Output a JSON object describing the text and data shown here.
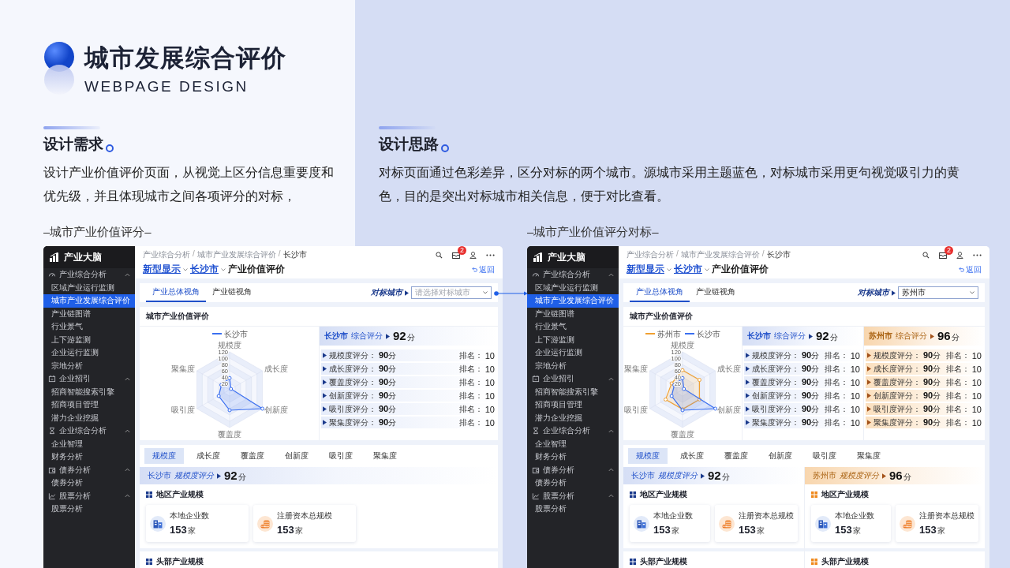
{
  "header": {
    "title": "城市发展综合评价",
    "subtitle": "WEBPAGE DESIGN"
  },
  "notes": [
    {
      "heading": "设计需求",
      "text": "设计产业价值评价页面，从视觉上区分信息重要度和优先级，并且体现城市之间各项评分的对标，"
    },
    {
      "heading": "设计思路",
      "text": "对标页面通过色彩差异，区分对标的两个城市。源城市采用主题蓝色，对标城市采用更句视觉吸引力的黄色，目的是突出对标城市相关信息，便于对比查看。"
    }
  ],
  "screens": [
    {
      "caption": "–城市产业价值评分–",
      "logo": "产业大脑",
      "sidebar": [
        {
          "label": "产业综合分析",
          "expanded": true,
          "children": [
            {
              "label": "区域产业运行监测",
              "selected": false
            },
            {
              "label": "城市产业发展综合评价",
              "selected": true
            },
            {
              "label": "产业链图谱",
              "selected": false
            },
            {
              "label": "行业景气",
              "selected": false
            },
            {
              "label": "上下游监测",
              "selected": false
            },
            {
              "label": "企业运行监测",
              "selected": false
            },
            {
              "label": "宗地分析",
              "selected": false
            }
          ]
        },
        {
          "label": "企业招引",
          "expanded": true,
          "children": [
            {
              "label": "招商智能搜索引擎",
              "selected": false
            },
            {
              "label": "招商项目管理",
              "selected": false
            },
            {
              "label": "潜力企业挖掘",
              "selected": false
            }
          ]
        },
        {
          "label": "企业综合分析",
          "expanded": true,
          "children": [
            {
              "label": "企业智理",
              "selected": false
            },
            {
              "label": "财务分析",
              "selected": false
            }
          ]
        },
        {
          "label": "债券分析",
          "expanded": true,
          "children": [
            {
              "label": "债券分析",
              "selected": false
            }
          ]
        },
        {
          "label": "股票分析",
          "expanded": true,
          "children": [
            {
              "label": "股票分析",
              "selected": false
            }
          ]
        }
      ],
      "breadcrumb": [
        "产业综合分析",
        "/",
        "城市产业发展综合评价",
        "/",
        "长沙市"
      ],
      "badge": "2",
      "title_links": [
        "新型显示",
        "长沙市"
      ],
      "title": "产业价值评价",
      "back": "返回",
      "view_tabs": [
        {
          "label": "产业总体视角",
          "selected": true
        },
        {
          "label": "产业链视角",
          "selected": false
        }
      ],
      "compare_label": "对标城市",
      "compare_field": {
        "placeholder": "请选择对标城市"
      },
      "chart_title": "城市产业价值评价",
      "radar": {
        "legend": [
          {
            "label": "长沙市",
            "kind": "source",
            "color": "#3a6ff0"
          }
        ],
        "axes": [
          "规模度",
          "成长度",
          "创新度",
          "覆盖度",
          "吸引度",
          "聚集度"
        ],
        "ticks": [
          "120",
          "100",
          "80",
          "60",
          "40",
          "20"
        ]
      },
      "panels": [
        {
          "kind": "source",
          "city": "长沙市",
          "label": "综合评分",
          "score": "92",
          "unit": "分",
          "rows": [
            {
              "label": "规模度评分：",
              "score": "90",
              "unit": "分",
              "rank_label": "排名：",
              "rank": "10"
            },
            {
              "label": "成长度评分：",
              "score": "90",
              "unit": "分",
              "rank_label": "排名：",
              "rank": "10"
            },
            {
              "label": "覆盖度评分：",
              "score": "90",
              "unit": "分",
              "rank_label": "排名：",
              "rank": "10"
            },
            {
              "label": "创新度评分：",
              "score": "90",
              "unit": "分",
              "rank_label": "排名：",
              "rank": "10"
            },
            {
              "label": "吸引度评分：",
              "score": "90",
              "unit": "分",
              "rank_label": "排名：",
              "rank": "10"
            },
            {
              "label": "聚集度评分：",
              "score": "90",
              "unit": "分",
              "rank_label": "排名：",
              "rank": "10"
            }
          ]
        }
      ],
      "metric_tabs": [
        {
          "label": "规模度",
          "selected": true
        },
        {
          "label": "成长度",
          "selected": false
        },
        {
          "label": "覆盖度",
          "selected": false
        },
        {
          "label": "创新度",
          "selected": false
        },
        {
          "label": "吸引度",
          "selected": false
        },
        {
          "label": "聚集度",
          "selected": false
        }
      ],
      "columns": [
        {
          "kind": "source",
          "city": "长沙市",
          "label": "规模度评分",
          "score": "92",
          "unit": "分",
          "section": "地区产业规模",
          "cards": [
            {
              "label": "本地企业数",
              "value": "153",
              "unit": "家"
            },
            {
              "label": "注册资本总规模",
              "value": "153",
              "unit": "家"
            }
          ],
          "next_section": "头部产业规模"
        }
      ]
    },
    {
      "caption": "–城市产业价值评分对标–",
      "logo": "产业大脑",
      "sidebar": [
        {
          "label": "产业综合分析",
          "expanded": true,
          "children": [
            {
              "label": "区域产业运行监测",
              "selected": false
            },
            {
              "label": "城市产业发展综合评价",
              "selected": true
            },
            {
              "label": "产业链图谱",
              "selected": false
            },
            {
              "label": "行业景气",
              "selected": false
            },
            {
              "label": "上下游监测",
              "selected": false
            },
            {
              "label": "企业运行监测",
              "selected": false
            },
            {
              "label": "宗地分析",
              "selected": false
            }
          ]
        },
        {
          "label": "企业招引",
          "expanded": true,
          "children": [
            {
              "label": "招商智能搜索引擎",
              "selected": false
            },
            {
              "label": "招商项目管理",
              "selected": false
            },
            {
              "label": "潜力企业挖掘",
              "selected": false
            }
          ]
        },
        {
          "label": "企业综合分析",
          "expanded": true,
          "children": [
            {
              "label": "企业智理",
              "selected": false
            },
            {
              "label": "财务分析",
              "selected": false
            }
          ]
        },
        {
          "label": "债券分析",
          "expanded": true,
          "children": [
            {
              "label": "债券分析",
              "selected": false
            }
          ]
        },
        {
          "label": "股票分析",
          "expanded": true,
          "children": [
            {
              "label": "股票分析",
              "selected": false
            }
          ]
        }
      ],
      "breadcrumb": [
        "产业综合分析",
        "/",
        "城市产业发展综合评价",
        "/",
        "长沙市"
      ],
      "badge": "2",
      "title_links": [
        "新型显示",
        "长沙市"
      ],
      "title": "产业价值评价",
      "back": "返回",
      "view_tabs": [
        {
          "label": "产业总体视角",
          "selected": true
        },
        {
          "label": "产业链视角",
          "selected": false
        }
      ],
      "compare_label": "对标城市",
      "compare_field": {
        "value": "苏州市"
      },
      "chart_title": "城市产业价值评价",
      "radar": {
        "legend": [
          {
            "label": "苏州市",
            "kind": "target",
            "color": "#f0a030"
          },
          {
            "label": "长沙市",
            "kind": "source",
            "color": "#3a6ff0"
          }
        ],
        "axes": [
          "规模度",
          "成长度",
          "创新度",
          "覆盖度",
          "吸引度",
          "聚集度"
        ],
        "ticks": [
          "120",
          "100",
          "80",
          "60",
          "40",
          "20"
        ]
      },
      "panels": [
        {
          "kind": "source",
          "city": "长沙市",
          "label": "综合评分",
          "score": "92",
          "unit": "分",
          "rows": [
            {
              "label": "规模度评分：",
              "score": "90",
              "unit": "分",
              "rank_label": "排名：",
              "rank": "10"
            },
            {
              "label": "成长度评分：",
              "score": "90",
              "unit": "分",
              "rank_label": "排名：",
              "rank": "10"
            },
            {
              "label": "覆盖度评分：",
              "score": "90",
              "unit": "分",
              "rank_label": "排名：",
              "rank": "10"
            },
            {
              "label": "创新度评分：",
              "score": "90",
              "unit": "分",
              "rank_label": "排名：",
              "rank": "10"
            },
            {
              "label": "吸引度评分：",
              "score": "90",
              "unit": "分",
              "rank_label": "排名：",
              "rank": "10"
            },
            {
              "label": "聚集度评分：",
              "score": "90",
              "unit": "分",
              "rank_label": "排名：",
              "rank": "10"
            }
          ]
        },
        {
          "kind": "target",
          "city": "苏州市",
          "label": "综合评分",
          "score": "96",
          "unit": "分",
          "rows": [
            {
              "label": "规模度评分：",
              "score": "90",
              "unit": "分",
              "rank_label": "排名：",
              "rank": "10"
            },
            {
              "label": "成长度评分：",
              "score": "90",
              "unit": "分",
              "rank_label": "排名：",
              "rank": "10"
            },
            {
              "label": "覆盖度评分：",
              "score": "90",
              "unit": "分",
              "rank_label": "排名：",
              "rank": "10"
            },
            {
              "label": "创新度评分：",
              "score": "90",
              "unit": "分",
              "rank_label": "排名：",
              "rank": "10"
            },
            {
              "label": "吸引度评分：",
              "score": "90",
              "unit": "分",
              "rank_label": "排名：",
              "rank": "10"
            },
            {
              "label": "聚集度评分：",
              "score": "90",
              "unit": "分",
              "rank_label": "排名：",
              "rank": "10"
            }
          ]
        }
      ],
      "metric_tabs": [
        {
          "label": "规模度",
          "selected": true
        },
        {
          "label": "成长度",
          "selected": false
        },
        {
          "label": "覆盖度",
          "selected": false
        },
        {
          "label": "创新度",
          "selected": false
        },
        {
          "label": "吸引度",
          "selected": false
        },
        {
          "label": "聚集度",
          "selected": false
        }
      ],
      "columns": [
        {
          "kind": "source",
          "city": "长沙市",
          "label": "规模度评分",
          "score": "92",
          "unit": "分",
          "section": "地区产业规模",
          "cards": [
            {
              "label": "本地企业数",
              "value": "153",
              "unit": "家"
            },
            {
              "label": "注册资本总规模",
              "value": "153",
              "unit": "家"
            }
          ],
          "next_section": "头部产业规模"
        },
        {
          "kind": "target",
          "city": "苏州市",
          "label": "规模度评分",
          "score": "96",
          "unit": "分",
          "section": "地区产业规模",
          "cards": [
            {
              "label": "本地企业数",
              "value": "153",
              "unit": "家"
            },
            {
              "label": "注册资本总规模",
              "value": "153",
              "unit": "家"
            }
          ],
          "next_section": "头部产业规模"
        }
      ]
    }
  ]
}
